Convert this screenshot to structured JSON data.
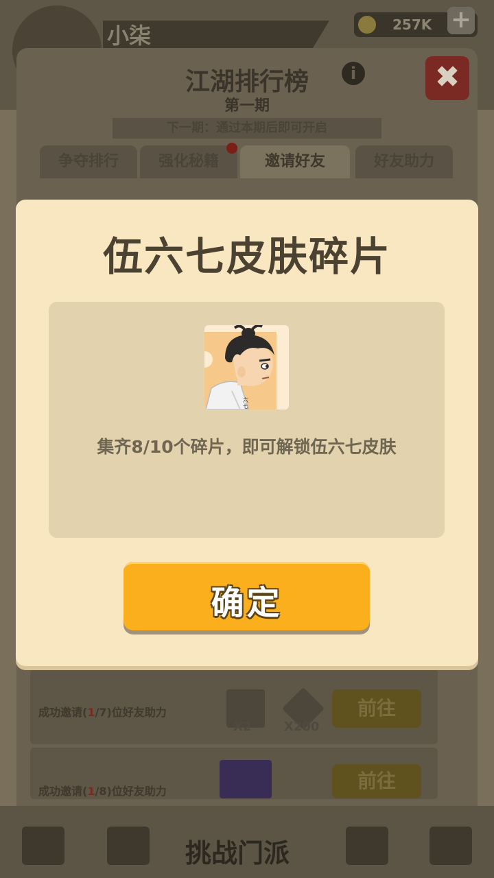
{
  "background": {
    "player_name": "小柒",
    "coins": "257K",
    "panel_title": "江湖排行榜",
    "panel_subtitle": "第一期",
    "next_period_text": "下一期：通过本期后即可开启",
    "tabs": [
      {
        "label": "争夺排行",
        "active": false
      },
      {
        "label": "强化秘籍",
        "active": false,
        "badge": true
      },
      {
        "label": "邀请好友",
        "active": true
      },
      {
        "label": "好友助力",
        "active": false
      }
    ],
    "tasks": [
      {
        "prefix": "成功邀请(",
        "count": "1",
        "suffix": "/7)位好友助力",
        "reward1": "X2",
        "reward2": "X200",
        "go_label": "前往"
      },
      {
        "prefix": "成功邀请(",
        "count": "1",
        "suffix": "/8)位好友助力",
        "go_label": "前往"
      }
    ],
    "bottom_center_label": "挑战门派",
    "close_icon": "close-icon",
    "info_icon": "info-icon"
  },
  "modal": {
    "title": "伍六七皮肤碎片",
    "item_icon": "character-skin-fragment-icon",
    "description": "集齐8/10个碎片，即可解锁伍六七皮肤",
    "confirm_label": "确定"
  },
  "colors": {
    "modal_bg": "#f9e7c1",
    "content_bg": "#e2d2ad",
    "confirm_button": "#fbaf1d",
    "title_text": "#4b4232"
  }
}
